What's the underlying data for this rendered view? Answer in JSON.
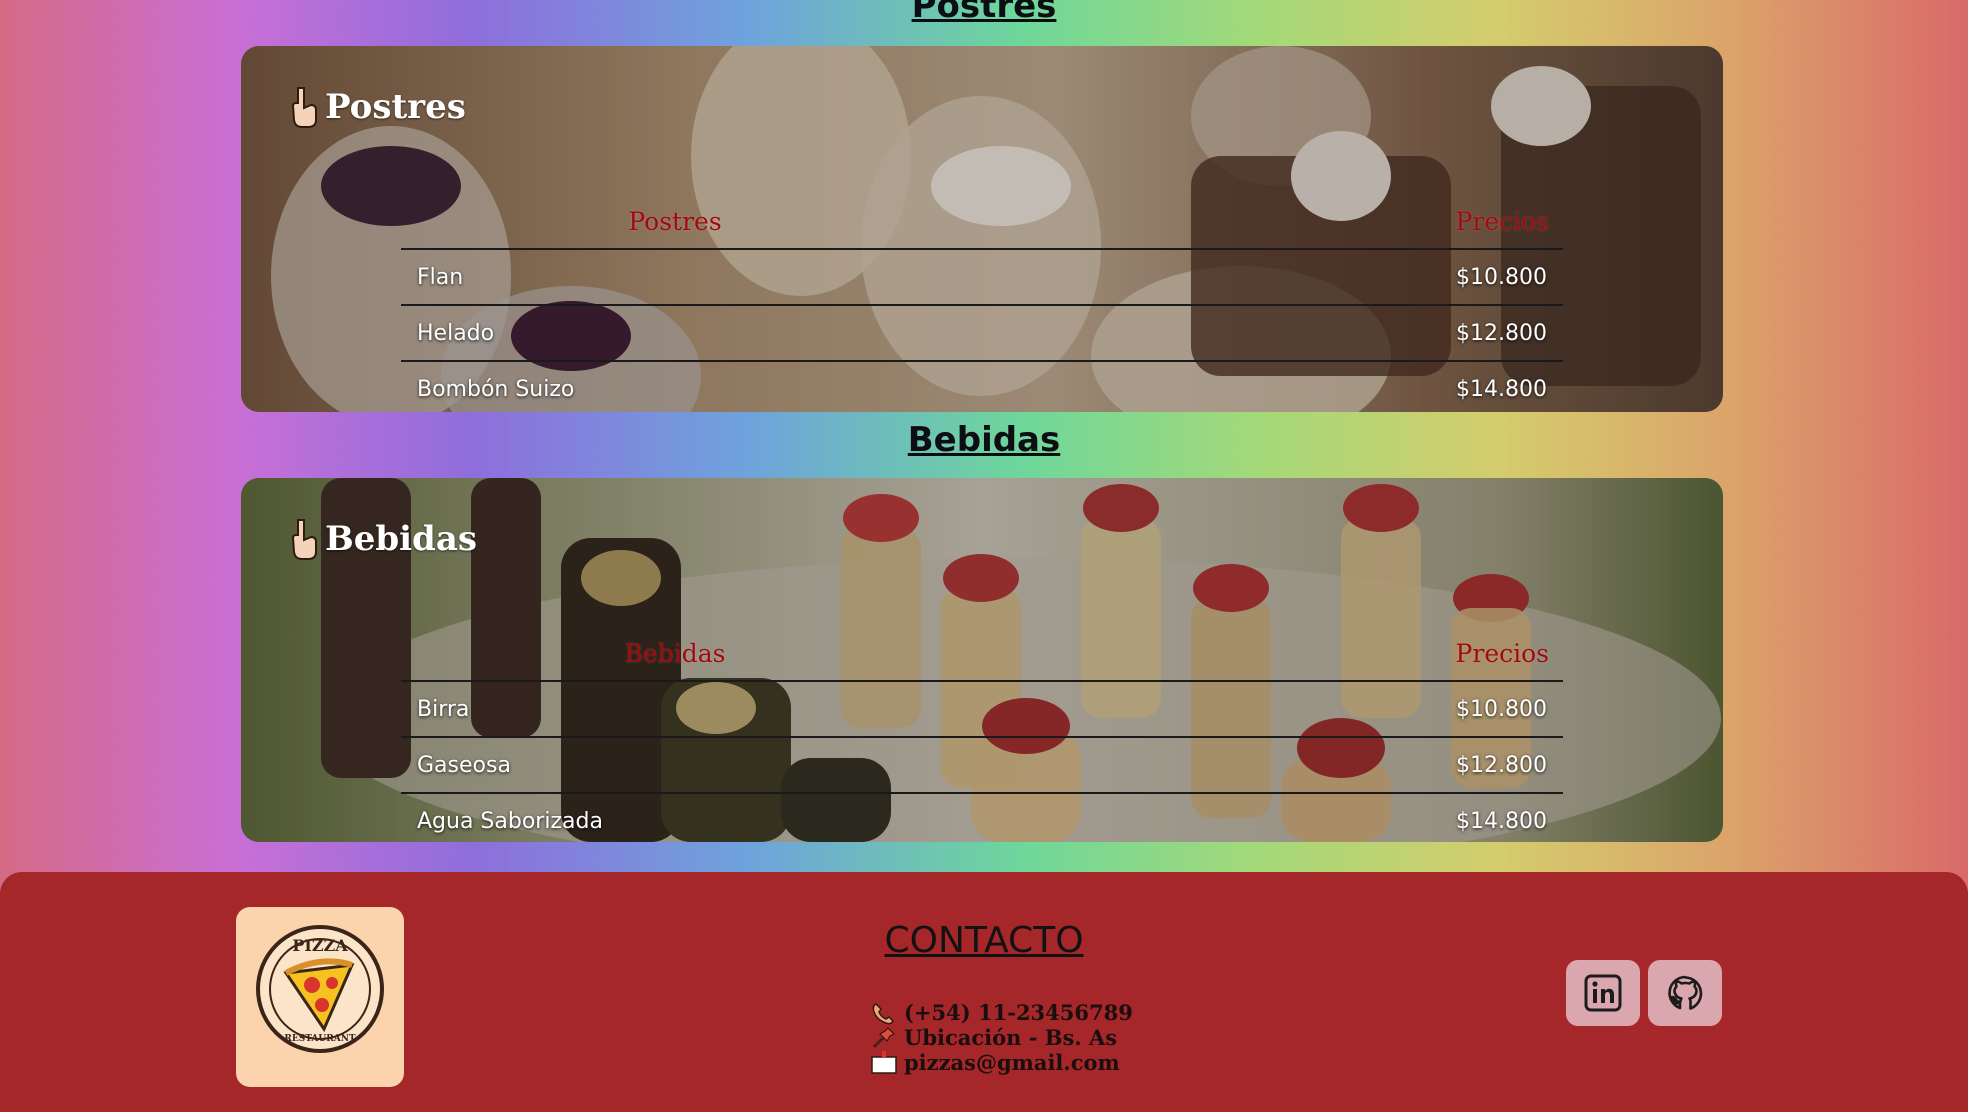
{
  "sections": {
    "postres": {
      "heading": "Postres",
      "card_title": "Postres",
      "col_item": "Postres",
      "col_price": "Precios",
      "rows": [
        {
          "item": "Flan",
          "price": "$10.800"
        },
        {
          "item": "Helado",
          "price": "$12.800"
        },
        {
          "item": "Bombón Suizo",
          "price": "$14.800"
        }
      ]
    },
    "bebidas": {
      "heading": "Bebidas",
      "card_title": "Bebidas",
      "col_item": "Bebidas",
      "col_price": "Precios",
      "rows": [
        {
          "item": "Birra",
          "price": "$10.800"
        },
        {
          "item": "Gaseosa",
          "price": "$12.800"
        },
        {
          "item": "Agua Saborizada",
          "price": "$14.800"
        }
      ]
    }
  },
  "footer": {
    "logo_top": "PIZZA",
    "logo_bottom": "RESTAURANT",
    "contact_title": "CONTACTO",
    "phone": "(+54) 11-23456789",
    "location": "Ubicación - Bs. As",
    "email": "pizzas@gmail.com",
    "social": [
      "linkedin-icon",
      "github-icon"
    ]
  },
  "colors": {
    "footer_bg": "#a52729",
    "header_red": "#a5080e",
    "logo_bg": "#fbd3ad",
    "social_bg": "#d9a7ad"
  }
}
